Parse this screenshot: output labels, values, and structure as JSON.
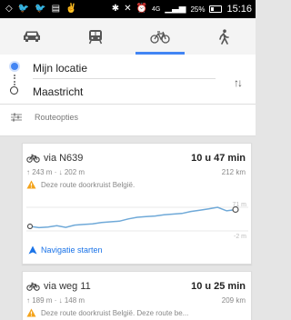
{
  "status_bar": {
    "battery": "25%",
    "time": "15:16",
    "icons": [
      "notification-icon",
      "twitter-icon",
      "twitter-icon",
      "gallery-icon",
      "game-icon",
      "bluetooth-icon",
      "mute-icon",
      "alarm-icon",
      "4g-icon",
      "signal-icon"
    ]
  },
  "transport_modes": [
    {
      "name": "car-icon",
      "active": false
    },
    {
      "name": "transit-icon",
      "active": false
    },
    {
      "name": "bicycle-icon",
      "active": true
    },
    {
      "name": "walking-icon",
      "active": false
    }
  ],
  "route": {
    "from": "Mijn locatie",
    "to": "Maastricht",
    "options_label": "Routeopties"
  },
  "routes": [
    {
      "via": "via N639",
      "duration": "10 u 47 min",
      "ascent": "243 m",
      "descent": "202 m",
      "distance": "212 km",
      "warning": "Deze route doorkruist België.",
      "elevation_max_label": "71 m",
      "elevation_min_label": "-2 m",
      "elevation_profile": [
        12,
        8,
        10,
        14,
        9,
        16,
        18,
        20,
        24,
        26,
        28,
        35,
        40,
        42,
        44,
        48,
        50,
        52,
        58,
        62,
        66,
        71,
        60,
        64
      ],
      "nav_label": "Navigatie starten"
    },
    {
      "via": "via weg 11",
      "duration": "10 u 25 min",
      "ascent": "189 m",
      "descent": "148 m",
      "distance": "209 km",
      "warning": "Deze route doorkruist België. Deze route be..."
    }
  ],
  "colors": {
    "accent": "#4285f4",
    "profile_line": "#6fa9d8",
    "warning": "#f4a31a"
  }
}
